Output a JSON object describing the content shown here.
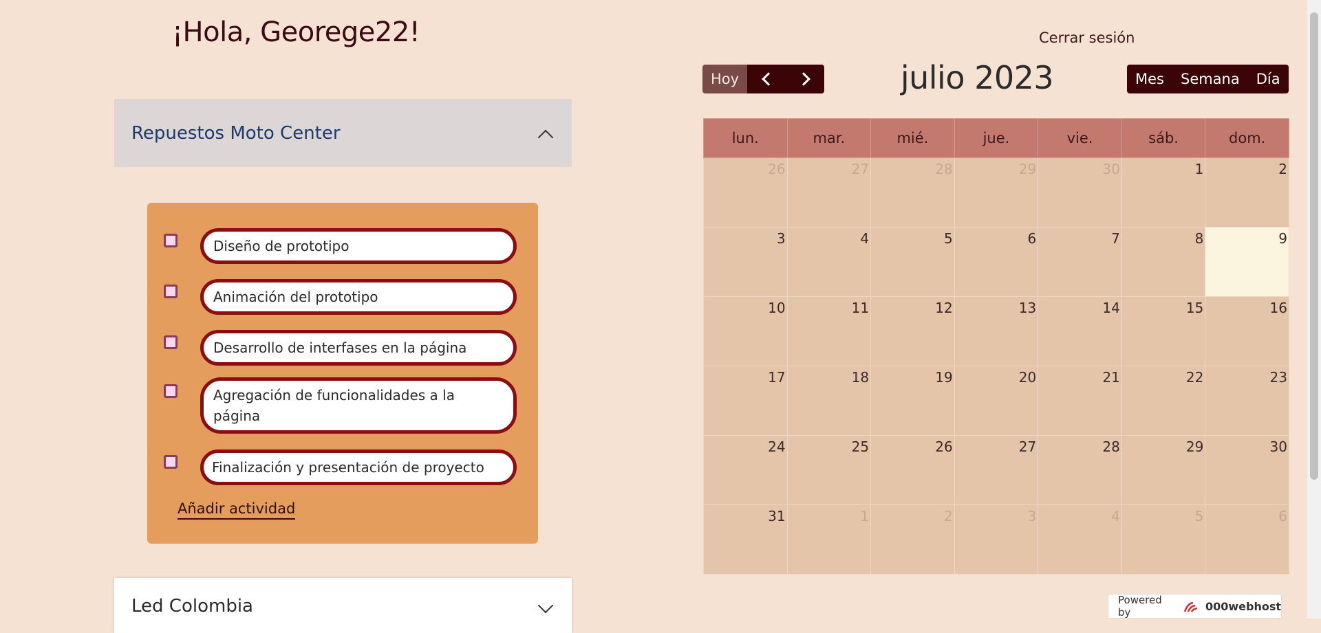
{
  "header": {
    "greeting": "¡Hola, Georege22!",
    "logout": "Cerrar sesión"
  },
  "projects": [
    {
      "title": "Repuestos Moto Center",
      "expanded": true,
      "tasks": [
        {
          "label": "Diseño de prototipo",
          "checked": false
        },
        {
          "label": "Animación del prototipo",
          "checked": false
        },
        {
          "label": "Desarrollo de interfases en la página",
          "checked": false
        },
        {
          "label": "Agregación de funcionalidades a la página",
          "checked": false
        },
        {
          "label": "Finalización y presentación de proyecto",
          "checked": false
        }
      ],
      "add_activity": "Añadir actividad"
    },
    {
      "title": "Led Colombia",
      "expanded": false
    }
  ],
  "calendar": {
    "today_label": "Hoy",
    "title": "julio 2023",
    "views": [
      "Mes",
      "Semana",
      "Día"
    ],
    "weekdays": [
      "lun.",
      "mar.",
      "mié.",
      "jue.",
      "vie.",
      "sáb.",
      "dom."
    ],
    "weeks": [
      [
        {
          "d": "26",
          "o": true
        },
        {
          "d": "27",
          "o": true
        },
        {
          "d": "28",
          "o": true
        },
        {
          "d": "29",
          "o": true
        },
        {
          "d": "30",
          "o": true
        },
        {
          "d": "1"
        },
        {
          "d": "2"
        }
      ],
      [
        {
          "d": "3"
        },
        {
          "d": "4"
        },
        {
          "d": "5"
        },
        {
          "d": "6"
        },
        {
          "d": "7"
        },
        {
          "d": "8"
        },
        {
          "d": "9",
          "t": true
        }
      ],
      [
        {
          "d": "10"
        },
        {
          "d": "11"
        },
        {
          "d": "12"
        },
        {
          "d": "13"
        },
        {
          "d": "14"
        },
        {
          "d": "15"
        },
        {
          "d": "16"
        }
      ],
      [
        {
          "d": "17"
        },
        {
          "d": "18"
        },
        {
          "d": "19"
        },
        {
          "d": "20"
        },
        {
          "d": "21"
        },
        {
          "d": "22"
        },
        {
          "d": "23"
        }
      ],
      [
        {
          "d": "24"
        },
        {
          "d": "25"
        },
        {
          "d": "26"
        },
        {
          "d": "27"
        },
        {
          "d": "28"
        },
        {
          "d": "29"
        },
        {
          "d": "30"
        }
      ],
      [
        {
          "d": "31"
        },
        {
          "d": "1",
          "o": true
        },
        {
          "d": "2",
          "o": true
        },
        {
          "d": "3",
          "o": true
        },
        {
          "d": "4",
          "o": true
        },
        {
          "d": "5",
          "o": true
        },
        {
          "d": "6",
          "o": true
        }
      ]
    ]
  },
  "footer": {
    "powered_by": "Powered by",
    "brand": "000webhost"
  },
  "colors": {
    "background": "#f5e2d3",
    "accent_dark": "#3b0508",
    "task_panel": "#e59d5e",
    "pill_border": "#8a0d12",
    "weekday_header": "#c4796f",
    "day_cell": "#e4c5aa",
    "today_cell": "#fbf4df"
  }
}
